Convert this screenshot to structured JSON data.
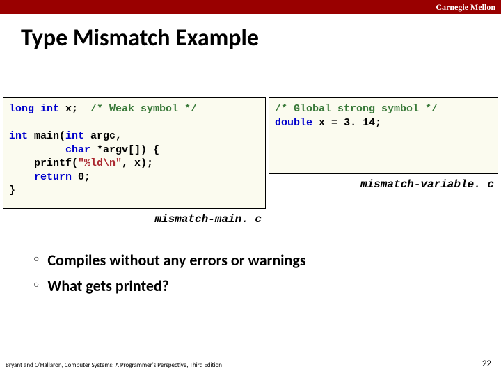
{
  "brand": "Carnegie Mellon",
  "title": "Type Mismatch Example",
  "code_left": {
    "tokens": [
      [
        {
          "t": "long int",
          "c": "c-kw"
        },
        {
          "t": " x;  ",
          "c": "c-nm"
        },
        {
          "t": "/* Weak symbol */",
          "c": "c-cm"
        }
      ],
      [
        {
          "t": "",
          "c": "c-nm"
        }
      ],
      [
        {
          "t": "int",
          "c": "c-kw"
        },
        {
          "t": " main(",
          "c": "c-nm"
        },
        {
          "t": "int",
          "c": "c-kw"
        },
        {
          "t": " argc,",
          "c": "c-nm"
        }
      ],
      [
        {
          "t": "         ",
          "c": "c-nm"
        },
        {
          "t": "char",
          "c": "c-kw"
        },
        {
          "t": " *argv[]) {",
          "c": "c-nm"
        }
      ],
      [
        {
          "t": "    printf(",
          "c": "c-nm"
        },
        {
          "t": "\"%ld\\n\"",
          "c": "c-str"
        },
        {
          "t": ", x);",
          "c": "c-nm"
        }
      ],
      [
        {
          "t": "    ",
          "c": "c-nm"
        },
        {
          "t": "return",
          "c": "c-kw"
        },
        {
          "t": " 0;",
          "c": "c-nm"
        }
      ],
      [
        {
          "t": "}",
          "c": "c-nm"
        }
      ]
    ],
    "filename": "mismatch-main. c"
  },
  "code_right": {
    "tokens": [
      [
        {
          "t": "/* Global strong symbol */",
          "c": "c-cm"
        }
      ],
      [
        {
          "t": "double",
          "c": "c-kw"
        },
        {
          "t": " ",
          "c": "c-nm"
        },
        {
          "t": "x",
          "c": "c-nm"
        },
        {
          "t": " = ",
          "c": "c-eq"
        },
        {
          "t": "3. 14;",
          "c": "c-nm"
        }
      ]
    ],
    "filename": "mismatch-variable. c"
  },
  "bullets": [
    "Compiles without any errors or warnings",
    "What gets printed?"
  ],
  "footer_left": "Bryant and O'Hallaron, Computer Systems: A Programmer's Perspective, Third Edition",
  "page_number": "22"
}
